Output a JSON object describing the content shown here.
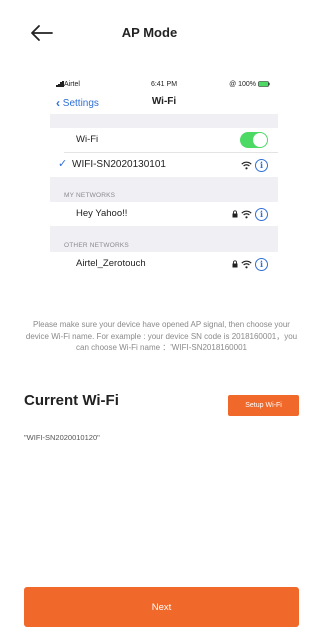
{
  "header": {
    "title": "AP Mode"
  },
  "phone": {
    "status": {
      "carrier": "Airtel",
      "time": "6:41 PM",
      "battery": "@ 100%"
    },
    "nav": {
      "back_label": "Settings",
      "title": "Wi-Fi"
    },
    "wifi_toggle": {
      "label": "Wi-Fi",
      "on": true
    },
    "connected": {
      "ssid": "WIFI-SN2020130101"
    },
    "my_networks": {
      "heading": "MY NETWORKS",
      "items": [
        {
          "ssid": "Hey Yahoo!!"
        }
      ]
    },
    "other_networks": {
      "heading": "OTHER NETWORKS",
      "items": [
        {
          "ssid": "Airtel_Zerotouch"
        }
      ]
    },
    "accent": "#2f6fd6",
    "toggle_color": "#4cd964"
  },
  "instructions": "Please make sure your device have opened AP signal, then choose your device Wi-Fi name. For example : your device SN code is 2018160001，you can choose Wi-Fi name ：'WIFI-SN2018160001",
  "current_wifi": {
    "title": "Current Wi-Fi",
    "setup_label": "Setup Wi-Fi",
    "value": "\"WIFI-SN2020010120\""
  },
  "footer": {
    "next_label": "Next"
  },
  "brand_color": "#f0692a"
}
